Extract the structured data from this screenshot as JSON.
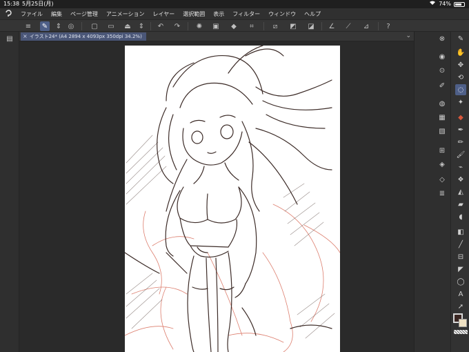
{
  "status": {
    "time": "15:38",
    "date": "5月25日(月)",
    "battery": "74%",
    "battery_level": 0.74
  },
  "menu": {
    "items": [
      "ファイル",
      "編集",
      "ページ管理",
      "アニメーション",
      "レイヤー",
      "選択範囲",
      "表示",
      "フィルター",
      "ウィンドウ",
      "ヘルプ"
    ]
  },
  "tab": {
    "title": "イラスト24* (A4 2894 x 4093px 350dpi 34.2%)",
    "close": "×"
  },
  "colors": {
    "main": "#3a2622",
    "sub": "#efe1c3",
    "accent": "#4e5f88",
    "line_art": "#3b2a26",
    "red_sketch": "#d9705e"
  },
  "command_icons": [
    "menu-icon",
    "pen-settings-icon",
    "chevron-updown-icon",
    "eye-icon",
    "new-canvas-icon",
    "open-folder-icon",
    "save-icon",
    "undo-icon",
    "redo-icon",
    "loading-icon",
    "clear-icon",
    "fill-icon",
    "crop-icon",
    "deselect-icon",
    "invert-icon",
    "adjust-icon",
    "ruler-icon",
    "stroke-icon",
    "line-icon",
    "help-icon"
  ],
  "right_panel_icons": [
    "navigator-icon",
    "sub-tool-icon",
    "tool-property-icon",
    "brush-size-icon",
    "color-circle-icon",
    "color-set-icon",
    "intermediate-color-icon",
    "approximate-color-icon",
    "material-icon",
    "layer-property-icon",
    "layer-icon"
  ],
  "tool_icons": [
    "pen-tool-icon",
    "hand-icon",
    "move-layer-icon",
    "rotate-icon",
    "lasso-icon",
    "magic-wand-icon",
    "eyedropper-icon",
    "pen-icon",
    "pencil-icon",
    "brush-icon",
    "airbrush-icon",
    "decoration-icon",
    "fill-bucket-icon",
    "eraser-icon",
    "blend-icon",
    "gradient-icon",
    "line-tool-icon",
    "frame-icon",
    "ruler-tool-icon",
    "balloon-icon",
    "text-icon",
    "operation-icon"
  ]
}
